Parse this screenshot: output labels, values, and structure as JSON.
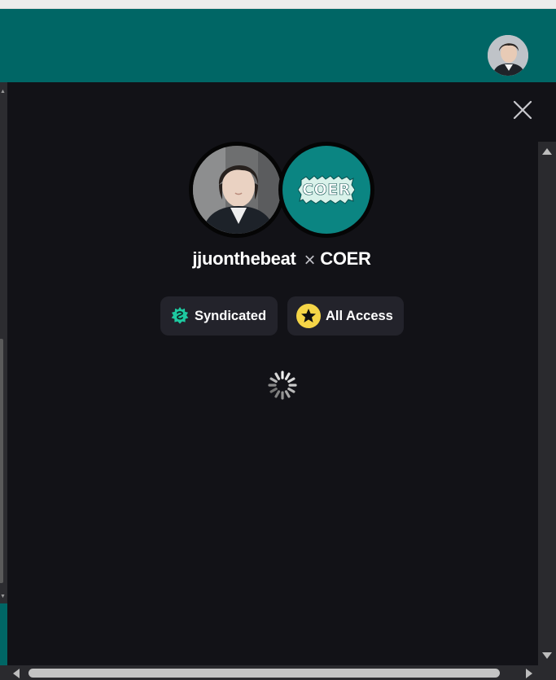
{
  "header": {
    "avatar_label": "User avatar"
  },
  "modal": {
    "creator_name": "jjuonthebeat",
    "separator": "×",
    "partner_name": "COER",
    "partner_logo_text": "COER",
    "badges": [
      {
        "label": "Syndicated",
        "icon": "syndicated-icon",
        "color": "#1ec9a0"
      },
      {
        "label": "All Access",
        "icon": "star-icon",
        "color": "#f5d547"
      }
    ],
    "loading": true
  },
  "colors": {
    "header_bg": "#006665",
    "modal_bg": "#121217",
    "badge_bg": "#23232b",
    "coer_bg": "#0b8582"
  }
}
